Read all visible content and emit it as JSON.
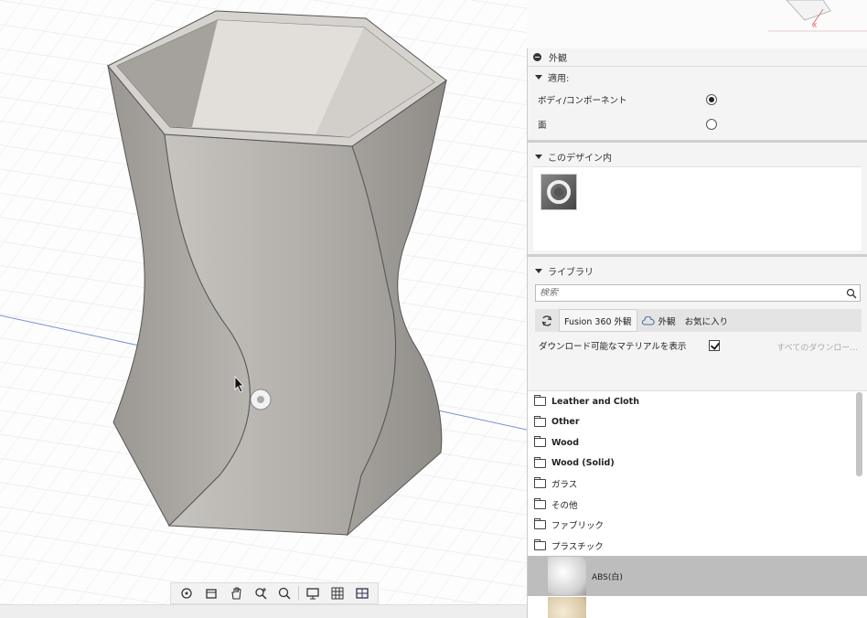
{
  "panel": {
    "title": "外観",
    "apply": {
      "heading": "適用:",
      "options": [
        {
          "label": "ボディ/コンポーネント",
          "selected": true
        },
        {
          "label": "面",
          "selected": false
        }
      ]
    },
    "in_design": {
      "heading": "このデザイン内"
    },
    "library": {
      "heading": "ライブラリ",
      "search_placeholder": "検索",
      "tabs": [
        {
          "label": "Fusion 360 外観",
          "active": true
        },
        {
          "label": "外観",
          "active": false,
          "icon": "cloud-icon"
        },
        {
          "label": "お気に入り",
          "active": false
        }
      ],
      "download_label": "ダウンロード可能なマテリアルを表示",
      "download_checked": true,
      "download_all": "すべてのダウンロー...",
      "folders": [
        {
          "label": "Leather and Cloth",
          "bold": true
        },
        {
          "label": "Other",
          "bold": true
        },
        {
          "label": "Wood",
          "bold": true
        },
        {
          "label": "Wood (Solid)",
          "bold": true
        },
        {
          "label": "ガラス",
          "bold": false
        },
        {
          "label": "その他",
          "bold": false
        },
        {
          "label": "ファブリック",
          "bold": false
        },
        {
          "label": "プラスチック",
          "bold": false
        }
      ],
      "materials": [
        {
          "label": "ABS(白)",
          "selected": true
        },
        {
          "label": "",
          "selected": false
        }
      ]
    }
  },
  "colors": {
    "accent": "#222222",
    "model_gray": "#a9a6a1",
    "selected_row": "#bdbdbd",
    "grid_line": "#e2e2e2",
    "axis_red": "#e57373",
    "axis_blue": "#7b8fd6"
  }
}
